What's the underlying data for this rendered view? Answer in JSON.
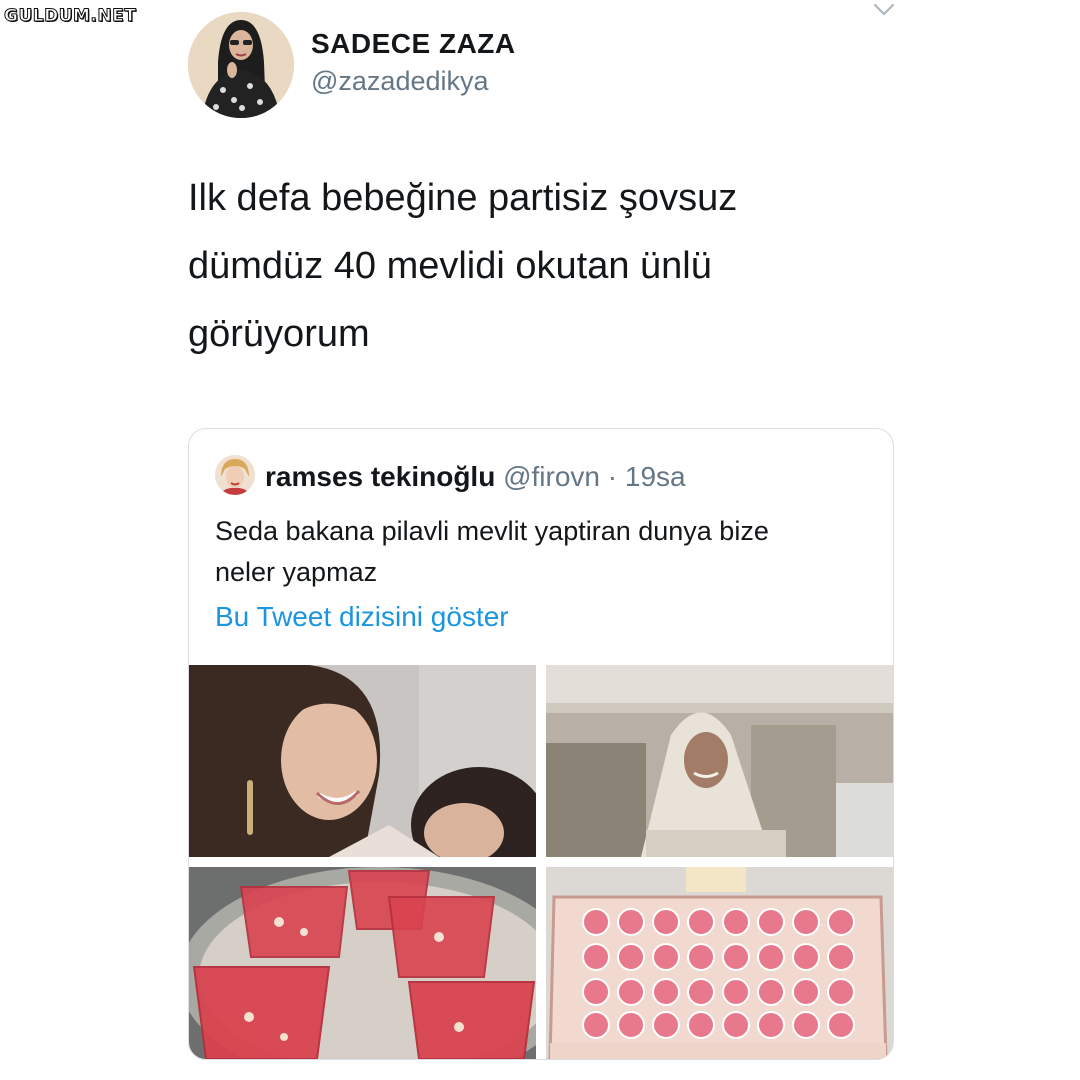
{
  "watermark": "GULDUM.NET",
  "tweet": {
    "display_name": "SADECE ZAZA",
    "handle": "@zazadedikya",
    "text_lines": [
      "Ilk defa bebeğine partisiz şovsuz",
      "dümdüz 40 mevlidi okutan ünlü",
      "görüyorum"
    ],
    "menu_icon": "chevron-down-icon",
    "avatar_icon": "profile-photo"
  },
  "quoted": {
    "name": "ramses tekinoğlu",
    "handle": "@firovn",
    "separator": "·",
    "time": "19sa",
    "text_lines": [
      "Seda bakana pilavli mevlit yaptiran dunya bize",
      "neler yapmaz"
    ],
    "thread_link": "Bu Tweet dizisini göster",
    "photos": [
      "woman-with-baby-photo",
      "woman-in-white-veil-photo",
      "red-drink-cups-photo",
      "pink-baby-favors-box-photo"
    ]
  },
  "colors": {
    "text": "#14171a",
    "secondary": "#657786",
    "link": "#1b95e0",
    "border": "#d9dee2"
  }
}
